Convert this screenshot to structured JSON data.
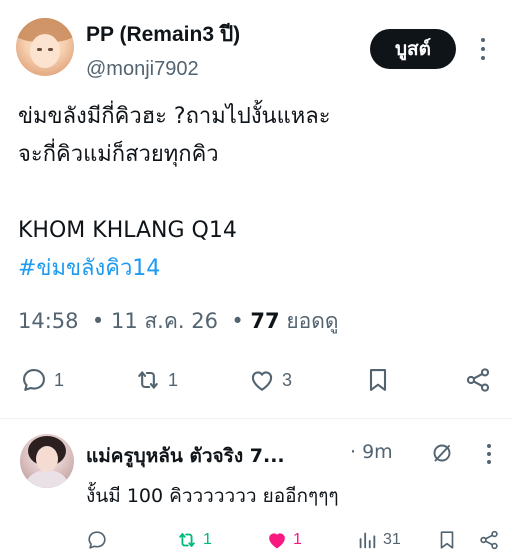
{
  "post": {
    "display_name": "PP (Remain3 ปี)",
    "handle": "@monji7902",
    "boost_label": "บูสต์",
    "body_lines": [
      "ข่มขลังมีกี่คิวฮะ ?ถามไปงั้นแหละ",
      "จะกี่คิวแม่ก็สวยทุกคิว",
      "KHOM KHLANG Q14"
    ],
    "hashtag": "#ข่มขลังคิว14",
    "meta": {
      "time": "14:58",
      "date": "11 ส.ค. 26",
      "views_count": "77",
      "views_label": "ยอดดู"
    },
    "actions": {
      "reply_count": "1",
      "repost_count": "1",
      "like_count": "3"
    }
  },
  "reply": {
    "display_name": "แม่ครูบุหลัน ตัวจริง 7...",
    "time": "· 9m",
    "text": "งั้นมี 100 คิววววววว ยออีกๆๆๆ",
    "actions": {
      "repost_count": "1",
      "like_count": "1",
      "views_count": "31"
    }
  },
  "colors": {
    "text": "#0f1419",
    "secondary": "#536471",
    "link": "#1d9bf0",
    "repost_active": "#00ba7c",
    "like_active": "#f91880",
    "button_bg": "#0f1419"
  }
}
